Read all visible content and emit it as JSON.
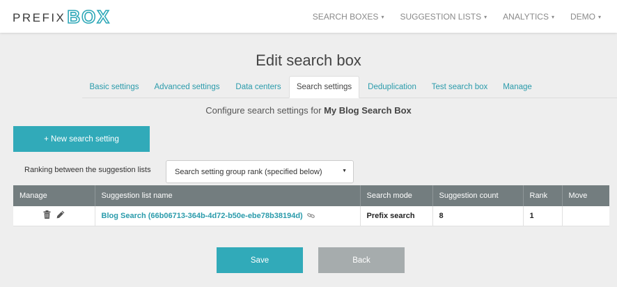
{
  "brand": {
    "prefix": "PREFIX",
    "box": "BOX",
    "accent": "#2ea8b8"
  },
  "nav": {
    "items": [
      {
        "label": "SEARCH BOXES"
      },
      {
        "label": "SUGGESTION LISTS"
      },
      {
        "label": "ANALYTICS"
      },
      {
        "label": "DEMO"
      }
    ],
    "caret": "▾"
  },
  "page": {
    "title": "Edit search box",
    "subtitle_prefix": "Configure search settings for",
    "search_box_name": "My Blog Search Box"
  },
  "tabs": [
    {
      "label": "Basic settings",
      "active": false
    },
    {
      "label": "Advanced settings",
      "active": false
    },
    {
      "label": "Data centers",
      "active": false
    },
    {
      "label": "Search settings",
      "active": true
    },
    {
      "label": "Deduplication",
      "active": false
    },
    {
      "label": "Test search box",
      "active": false
    },
    {
      "label": "Manage",
      "active": false
    }
  ],
  "new_button": {
    "label": "+ New search setting"
  },
  "ranking": {
    "label": "Ranking between the suggestion lists",
    "selected": "Search setting group rank (specified below)",
    "arrow": "▼"
  },
  "table": {
    "headers": [
      "Manage",
      "Suggestion list name",
      "Search mode",
      "Suggestion count",
      "Rank",
      "Move"
    ],
    "rows": [
      {
        "name": "Blog Search (66b06713-364b-4d72-b50e-ebe78b38194d)",
        "mode": "Prefix search",
        "count": "8",
        "rank": "1",
        "move": ""
      }
    ]
  },
  "actions": {
    "save": "Save",
    "back": "Back"
  },
  "colors": {
    "primary": "#31aab9",
    "header_bg": "#737d7f",
    "back_bg": "#a6acad",
    "page_bg": "#eeeeee"
  }
}
